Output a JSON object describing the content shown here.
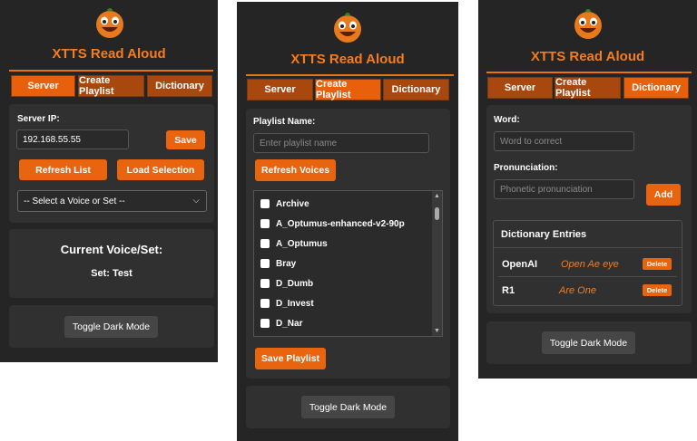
{
  "app": {
    "title": "XTTS Read Aloud"
  },
  "tabs": [
    "Server",
    "Create Playlist",
    "Dictionary"
  ],
  "colors": {
    "accent": "#e8640f",
    "panel": "#252525",
    "card": "#303030"
  },
  "icons": {
    "logo": "pumpkin-logo-icon"
  },
  "server": {
    "ip_label": "Server IP:",
    "ip_value": "192.168.55.55",
    "save_label": "Save",
    "refresh_label": "Refresh List",
    "load_label": "Load Selection",
    "select_value": "-- Select a Voice or Set --",
    "current_heading": "Current Voice/Set:",
    "current_value": "Set: Test",
    "toggle_label": "Toggle Dark Mode"
  },
  "playlist": {
    "name_label": "Playlist Name:",
    "name_placeholder": "Enter playlist name",
    "refresh_label": "Refresh Voices",
    "voices": [
      "Archive",
      "A_Optumus-enhanced-v2-90p",
      "A_Optumus",
      "Bray",
      "D_Dumb",
      "D_Invest",
      "D_Nar"
    ],
    "save_label": "Save Playlist",
    "toggle_label": "Toggle Dark Mode"
  },
  "dictionary": {
    "word_label": "Word:",
    "word_placeholder": "Word to correct",
    "pron_label": "Pronunciation:",
    "pron_placeholder": "Phonetic pronunciation",
    "add_label": "Add",
    "entries_heading": "Dictionary Entries",
    "entries": [
      {
        "word": "OpenAI",
        "pronunciation": "Open Ae eye"
      },
      {
        "word": "R1",
        "pronunciation": "Are One"
      }
    ],
    "delete_label": "Delete",
    "toggle_label": "Toggle Dark Mode"
  }
}
